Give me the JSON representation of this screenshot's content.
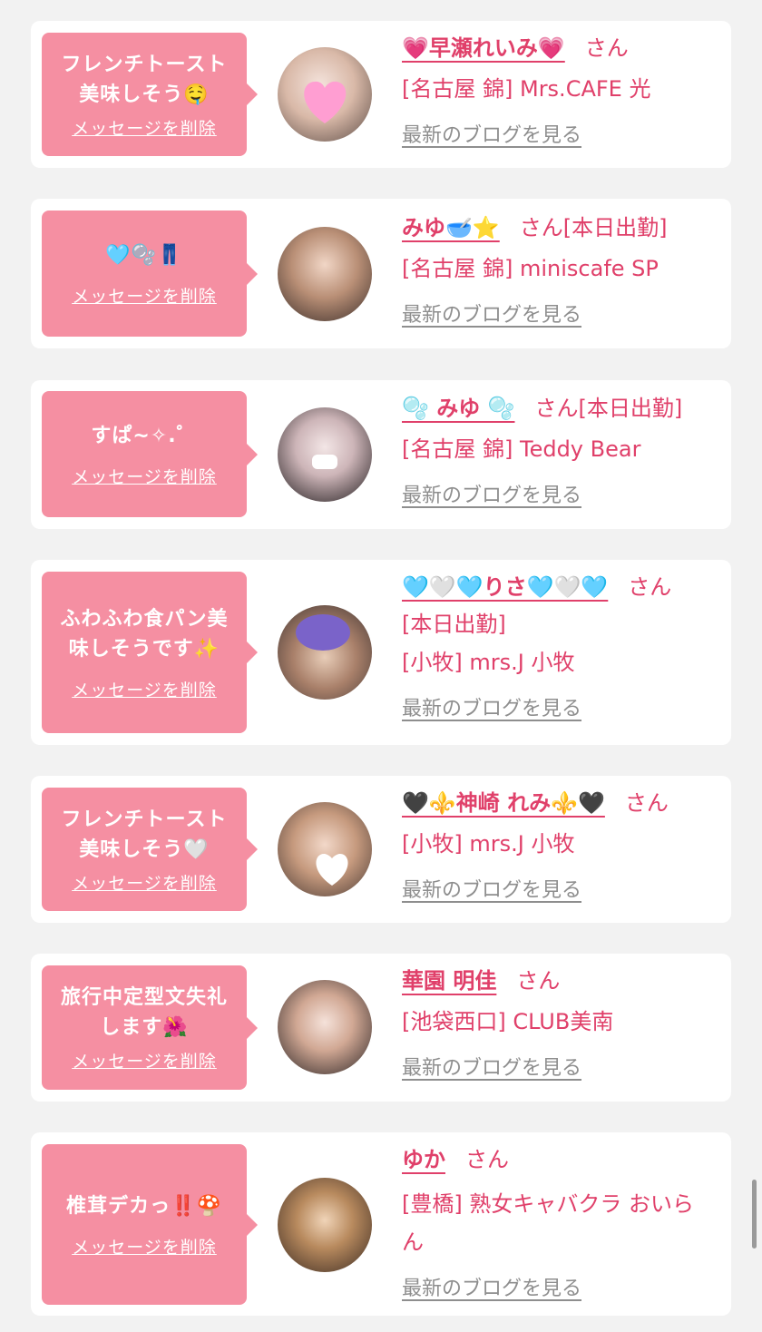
{
  "delete_label": "メッセージを削除",
  "blog_label": "最新のブログを見る",
  "san_label": "さん",
  "colors": {
    "accent": "#e0406a",
    "bubble": "#f58fa2",
    "background": "#f2f2f2",
    "link_gray": "#8e8e8e"
  },
  "cards": [
    {
      "message": "フレンチトースト美味しそう🤤",
      "name": "💗早瀬れいみ💗",
      "status": "",
      "shop": "[名古屋 錦] Mrs.CAFE 光",
      "avatar_icon": "avatar-photo-heart-sticker"
    },
    {
      "message": "🩵🫧👖",
      "name": "みゆ🥣⭐",
      "status": "[本日出勤]",
      "shop": "[名古屋 錦] miniscafe SP",
      "avatar_icon": "avatar-photo"
    },
    {
      "message": "すぱ~✧.゜",
      "name": "🫧 みゆ 🫧",
      "status": "[本日出勤]",
      "shop": "[名古屋 錦] Teddy Bear",
      "avatar_icon": "avatar-photo-mask"
    },
    {
      "message": "ふわふわ食パン美味しそうです✨",
      "name": "🩵🤍🩵りさ🩵🤍🩵",
      "status": "[本日出勤]",
      "shop": "[小牧] mrs.J 小牧",
      "avatar_icon": "avatar-photo-purple-sticker"
    },
    {
      "message": "フレンチトースト美味しそう🤍",
      "name": "🖤⚜️神崎 れみ⚜️🖤",
      "status": "",
      "shop": "[小牧] mrs.J 小牧",
      "avatar_icon": "avatar-photo-heart-sticker"
    },
    {
      "message": "旅行中定型文失礼します🌺",
      "name": "華園 明佳",
      "status": "",
      "shop": "[池袋西口] CLUB美南",
      "avatar_icon": "avatar-photo"
    },
    {
      "message": "椎茸デカっ‼️🍄",
      "name": "ゆか",
      "status": "",
      "shop": "[豊橋] 熟女キャバクラ おいらん",
      "avatar_icon": "avatar-photo"
    }
  ]
}
